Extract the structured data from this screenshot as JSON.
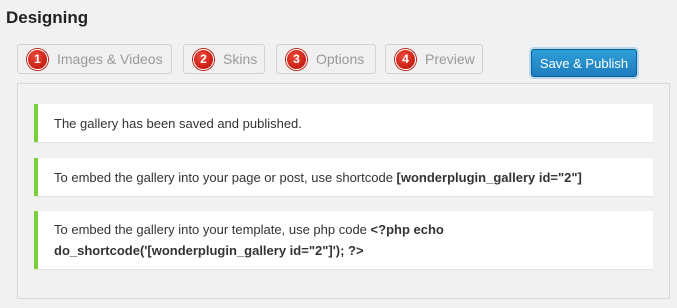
{
  "page": {
    "title": "Designing"
  },
  "tabs": [
    {
      "number": "1",
      "label": "Images & Videos"
    },
    {
      "number": "2",
      "label": "Skins"
    },
    {
      "number": "3",
      "label": "Options"
    },
    {
      "number": "4",
      "label": "Preview"
    }
  ],
  "save_button": {
    "label": "Save & Publish"
  },
  "notices": {
    "saved": {
      "text": "The gallery has been saved and published."
    },
    "shortcode": {
      "text": "To embed the gallery into your page or post, use shortcode ",
      "code": "[wonderplugin_gallery id=\"2\"]"
    },
    "php": {
      "text": "To embed the gallery into your template, use php code ",
      "code": "<?php echo do_shortcode('[wonderplugin_gallery id=\"2\"]'); ?>"
    }
  },
  "colors": {
    "accent_blue": "#2088c8",
    "notice_green": "#7ad03a",
    "step_red": "#d9281c"
  }
}
